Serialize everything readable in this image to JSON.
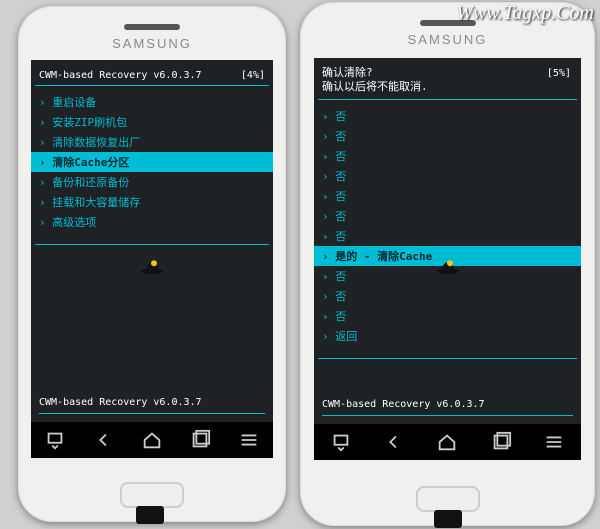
{
  "watermark": "Www.Tagxp.Com",
  "brand": "SAMSUNG",
  "left": {
    "header": "CWM-based Recovery v6.0.3.7",
    "battery": "[4%]",
    "menu_items": [
      "› 重启设备",
      "› 安装ZIP刷机包",
      "› 清除数据恢复出厂",
      "› 清除Cache分区",
      "› 备份和还原备份",
      "› 挂载和大容量储存",
      "› 高级选项"
    ],
    "selected_index": 3,
    "footer": "CWM-based Recovery v6.0.3.7"
  },
  "right": {
    "confirm_title": "确认清除?\n确认以后将不能取消.",
    "battery": "[5%]",
    "no_label": "› 否",
    "yes_label": "› 是的 - 清除Cache",
    "back_label": "› 返回",
    "no_before": 7,
    "no_after": 3,
    "footer": "CWM-based Recovery v6.0.3.7"
  }
}
